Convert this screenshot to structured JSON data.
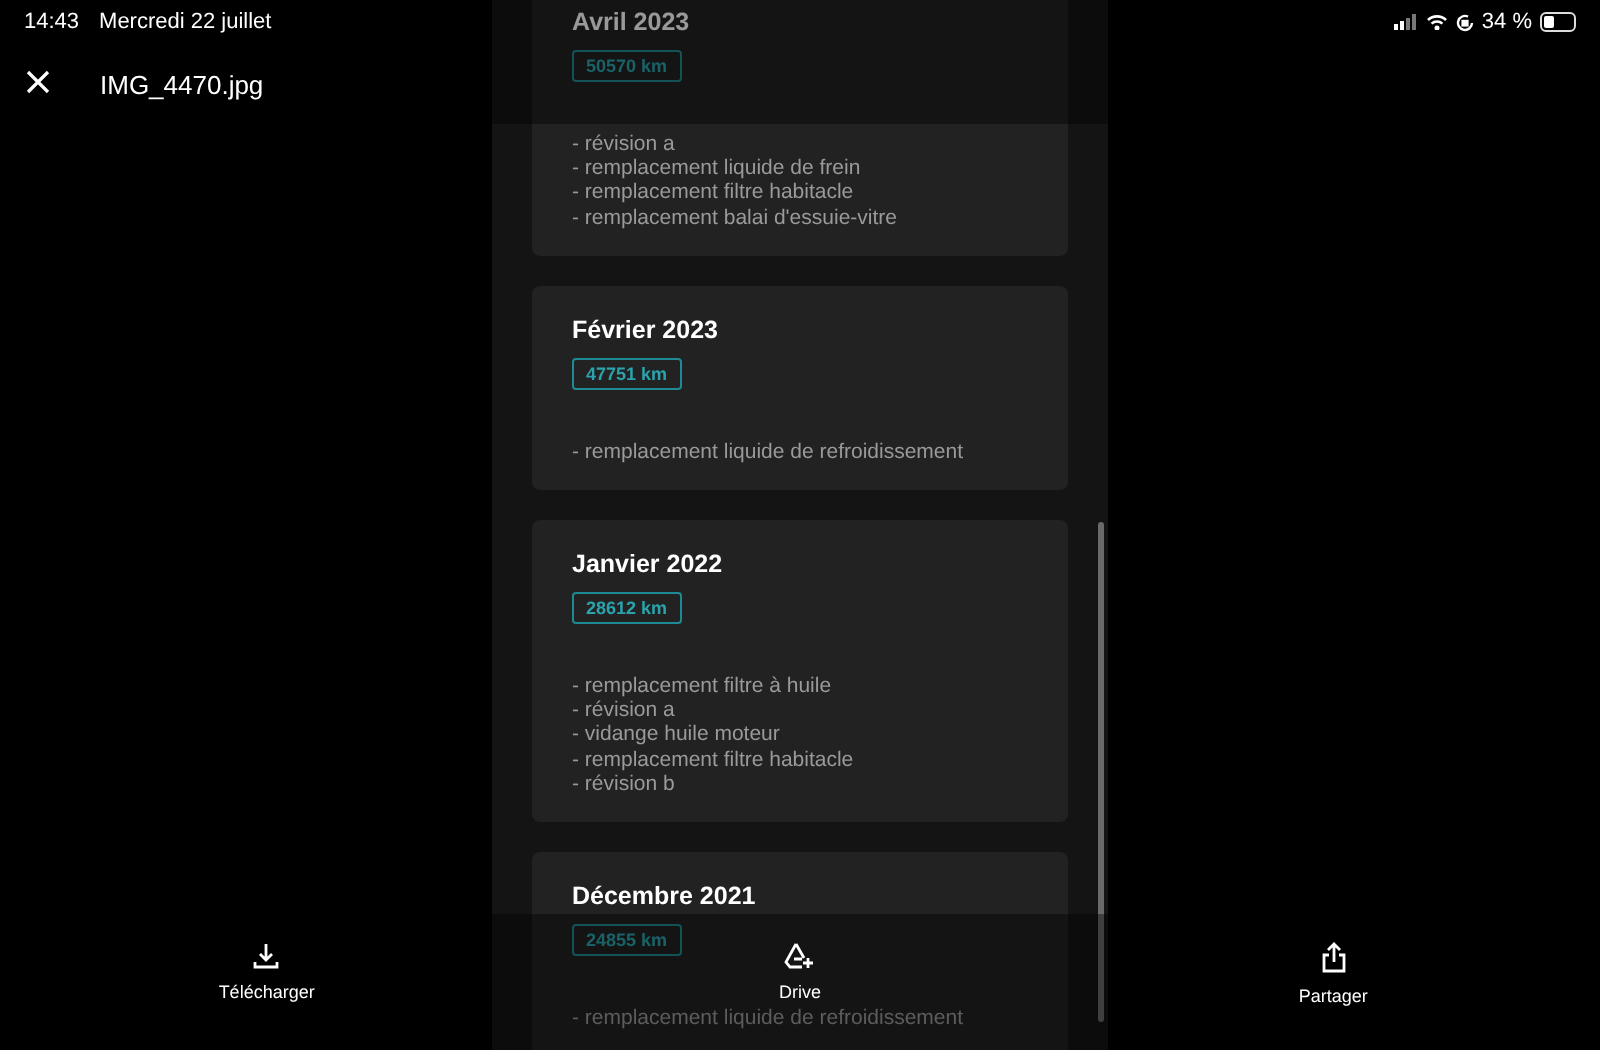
{
  "status_bar": {
    "time": "14:43",
    "date": "Mercredi 22 juillet",
    "battery": "34 %"
  },
  "header": {
    "title": "IMG_4470.jpg"
  },
  "entries": [
    {
      "title": "Avril 2023",
      "km": "50570 km",
      "items": [
        "- révision a",
        "- remplacement liquide de frein",
        "- remplacement filtre habitacle",
        "- remplacement balai d'essuie-vitre"
      ]
    },
    {
      "title": "Février 2023",
      "km": "47751 km",
      "items": [
        "- remplacement liquide de refroidissement"
      ]
    },
    {
      "title": "Janvier 2022",
      "km": "28612 km",
      "items": [
        "- remplacement filtre à huile",
        "- révision a",
        "- vidange huile moteur",
        "- remplacement filtre habitacle",
        "- révision b"
      ]
    },
    {
      "title": "Décembre 2021",
      "km": "24855 km",
      "items": [
        "- remplacement liquide de refroidissement"
      ]
    }
  ],
  "toolbar": [
    {
      "kind": "download",
      "label": "Télécharger"
    },
    {
      "kind": "drive",
      "label": "Drive"
    },
    {
      "kind": "share",
      "label": "Partager"
    }
  ]
}
